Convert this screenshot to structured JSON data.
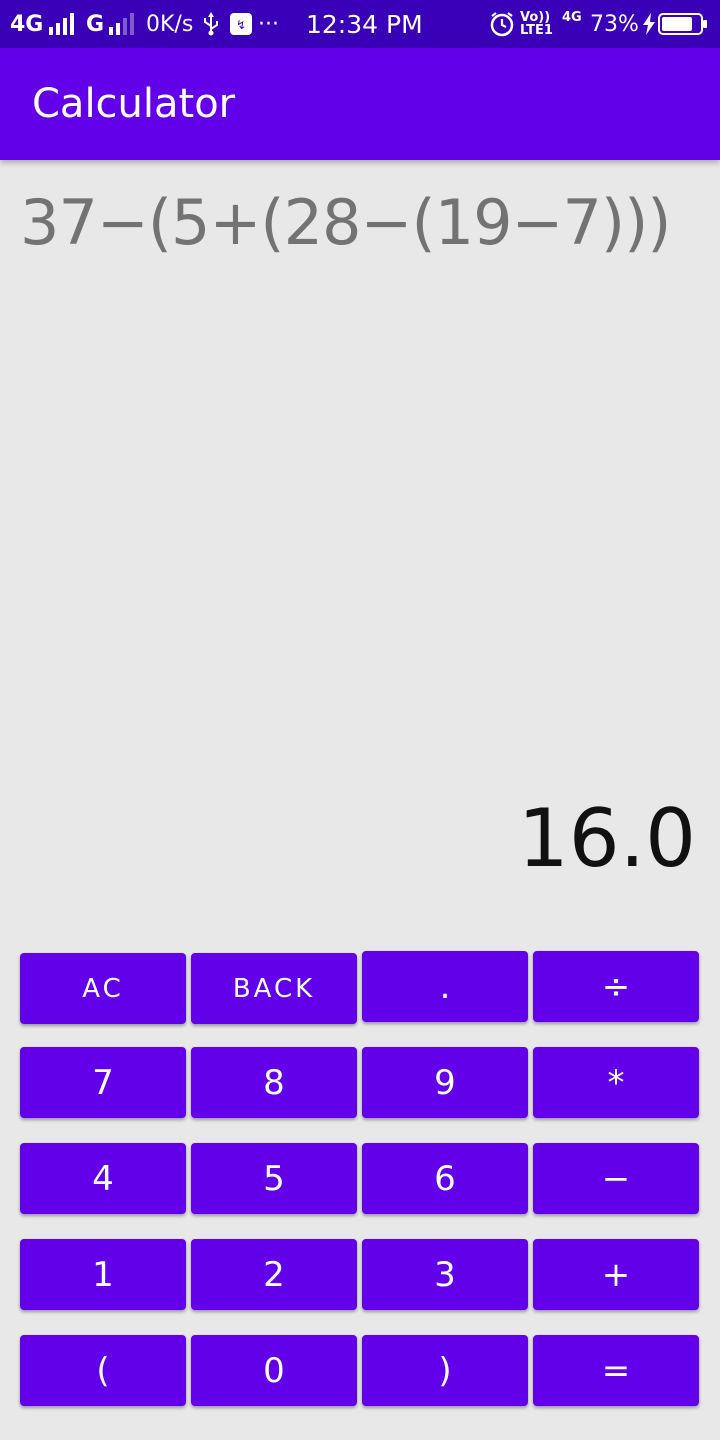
{
  "status_bar": {
    "network_left": "4G",
    "network_mid": "G",
    "speed": "0K/s",
    "usb_icon": "usb-icon",
    "more": "···",
    "time": "12:34 PM",
    "volte_top": "Vo))",
    "volte_bottom": "LTE1",
    "network_right": "4G",
    "battery": "73%"
  },
  "app_bar": {
    "title": "Calculator"
  },
  "display": {
    "expression": "37−(5+(28−(19−7)))",
    "result": "16.0"
  },
  "keypad": {
    "rows": [
      [
        "AC",
        "BACK",
        ".",
        "÷"
      ],
      [
        "7",
        "8",
        "9",
        "*"
      ],
      [
        "4",
        "5",
        "6",
        "−"
      ],
      [
        "1",
        "2",
        "3",
        "+"
      ],
      [
        "(",
        "0",
        ")",
        "="
      ]
    ]
  },
  "colors": {
    "primary": "#6200ea",
    "primary_dark": "#3a00b8",
    "background": "#e8e8e8"
  }
}
